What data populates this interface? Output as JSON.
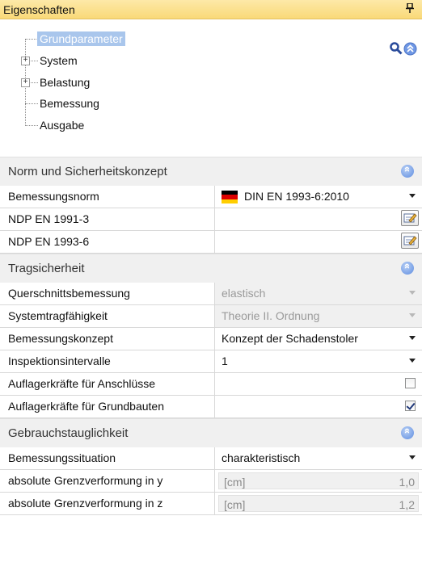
{
  "panel": {
    "title": "Eigenschaften",
    "pin_glyph": "p"
  },
  "tree": {
    "items": [
      {
        "label": "Grundparameter",
        "selected": true,
        "expandable": false
      },
      {
        "label": "System",
        "selected": false,
        "expandable": true
      },
      {
        "label": "Belastung",
        "selected": false,
        "expandable": true
      },
      {
        "label": "Bemessung",
        "selected": false,
        "expandable": false
      },
      {
        "label": "Ausgabe",
        "selected": false,
        "expandable": false
      }
    ],
    "tools": [
      "search-icon",
      "collapse-all-icon"
    ]
  },
  "sections": [
    {
      "title": "Norm und Sicherheitskonzept",
      "rows": [
        {
          "name": "Bemessungsnorm",
          "value": "DIN EN 1993-6:2010",
          "control": "dropdown-flag"
        },
        {
          "name": "NDP EN 1991-3",
          "value": "",
          "control": "edit-button"
        },
        {
          "name": "NDP EN 1993-6",
          "value": "",
          "control": "edit-button"
        }
      ]
    },
    {
      "title": "Tragsicherheit",
      "rows": [
        {
          "name": "Querschnittsbemessung",
          "value": "elastisch",
          "control": "dropdown-disabled"
        },
        {
          "name": "Systemtragfähigkeit",
          "value": "Theorie II. Ordnung",
          "control": "dropdown-disabled"
        },
        {
          "name": "Bemessungskonzept",
          "value": "Konzept der Schadenstoler",
          "control": "dropdown"
        },
        {
          "name": "Inspektionsintervalle",
          "value": "1",
          "control": "dropdown"
        },
        {
          "name": "Auflagerkräfte für Anschlüsse",
          "value": "",
          "control": "checkbox",
          "checked": false
        },
        {
          "name": "Auflagerkräfte für Grundbauten",
          "value": "",
          "control": "checkbox",
          "checked": true
        }
      ]
    },
    {
      "title": "Gebrauchstauglichkeit",
      "rows": [
        {
          "name": "Bemessungssituation",
          "value": "charakteristisch",
          "control": "dropdown"
        },
        {
          "name": "absolute Grenzverformung in y",
          "unit": "[cm]",
          "value": "1,0",
          "control": "number-disabled"
        },
        {
          "name": "absolute Grenzverformung in z",
          "unit": "[cm]",
          "value": "1,2",
          "control": "number-disabled"
        }
      ]
    }
  ],
  "colors": {
    "title_bar": "#f9d978",
    "selected_item": "#a9c6ec",
    "section_header": "#f0f0f0",
    "flag": [
      "#000000",
      "#dd0000",
      "#ffce00"
    ]
  }
}
